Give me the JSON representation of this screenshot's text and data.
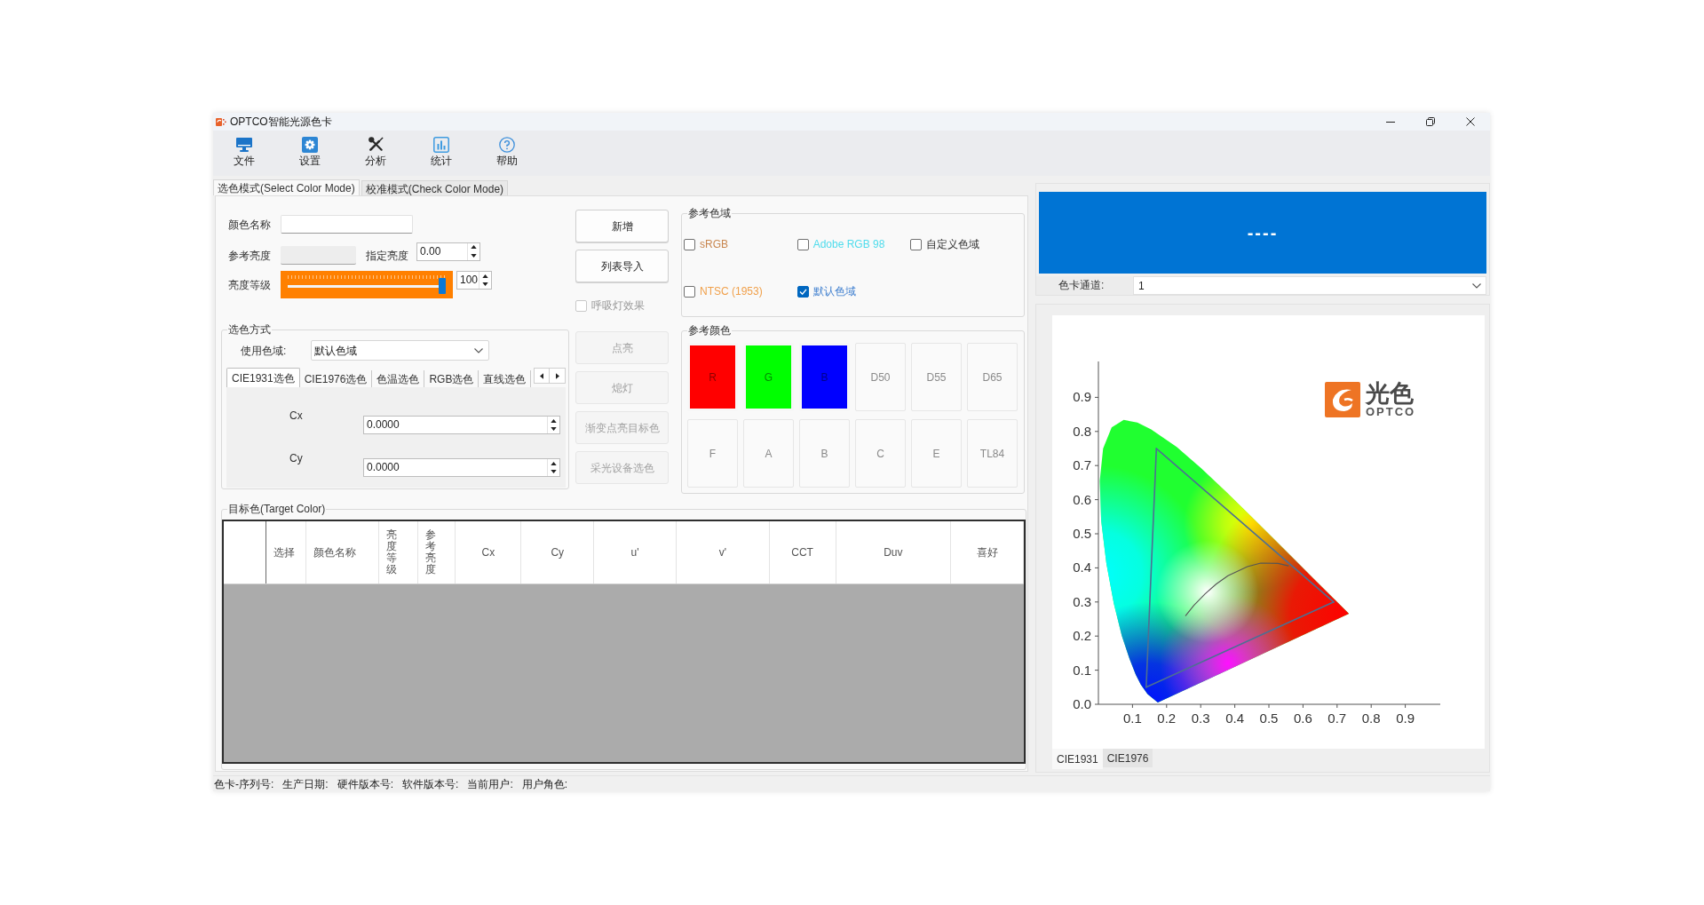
{
  "window": {
    "title": "OPTCO智能光源色卡"
  },
  "toolbar": [
    {
      "label": "文件"
    },
    {
      "label": "设置"
    },
    {
      "label": "分析"
    },
    {
      "label": "统计"
    },
    {
      "label": "帮助"
    }
  ],
  "mode_tabs": [
    {
      "label": "选色模式(Select Color Mode)",
      "selected": true
    },
    {
      "label": "校准模式(Check Color Mode)",
      "selected": false
    }
  ],
  "color_form": {
    "name": {
      "label": "颜色名称"
    },
    "reference_brightness": {
      "label": "参考亮度"
    },
    "set_brightness": {
      "label": "指定亮度",
      "value": "0.00"
    },
    "brightness_level": {
      "label": "亮度等级",
      "level": 1,
      "value": "100"
    }
  },
  "select_method": {
    "title": "选色方式",
    "gamut": {
      "label": "使用色域:",
      "value": "默认色域"
    },
    "tabs": [
      {
        "label": "CIE1931选色",
        "selected": true
      },
      {
        "label": "CIE1976选色",
        "selected": false
      },
      {
        "label": "色温选色",
        "selected": false
      },
      {
        "label": "RGB选色",
        "selected": false
      },
      {
        "label": "直线选色",
        "selected": false
      }
    ],
    "fields": [
      {
        "label": "Cx",
        "value": "0.0000"
      },
      {
        "label": "Cy",
        "value": "0.0000"
      }
    ]
  },
  "actions": [
    {
      "kind": "button",
      "label": "新增",
      "disabled": false
    },
    {
      "kind": "button",
      "label": "列表导入",
      "disabled": false
    },
    {
      "kind": "checkbox",
      "label": "呼吸灯效果",
      "checked": false,
      "disabled": true
    },
    {
      "kind": "button",
      "label": "点亮",
      "disabled": true
    },
    {
      "kind": "button",
      "label": "熄灯",
      "disabled": true
    },
    {
      "kind": "button",
      "label": "渐变点亮目标色",
      "disabled": true
    },
    {
      "kind": "button",
      "label": "采光设备选色",
      "disabled": true
    }
  ],
  "reference_gamut": {
    "title": "参考色域",
    "options": [
      {
        "label": "sRGB",
        "checked": false,
        "color": "#c8864f"
      },
      {
        "label": "Adobe RGB 98",
        "checked": false,
        "color": "#4fdcec"
      },
      {
        "label": "自定义色域",
        "checked": false,
        "color": "#333333"
      },
      {
        "label": "NTSC (1953)",
        "checked": false,
        "color": "#f0a04b"
      },
      {
        "label": "默认色域",
        "checked": true,
        "color": "#3f7fcf"
      }
    ]
  },
  "reference_colors": {
    "title": "参考颜色",
    "swatches": [
      {
        "label": "R",
        "color": "#ff0000"
      },
      {
        "label": "G",
        "color": "#00ff00"
      },
      {
        "label": "B",
        "color": "#0000ff"
      },
      {
        "label": "D50"
      },
      {
        "label": "D55"
      },
      {
        "label": "D65"
      },
      {
        "label": "F"
      },
      {
        "label": "A"
      },
      {
        "label": "B"
      },
      {
        "label": "C"
      },
      {
        "label": "E"
      },
      {
        "label": "TL84"
      }
    ]
  },
  "target_color": {
    "title": "目标色(Target Color)",
    "columns": [
      "选择",
      "颜色名称",
      "亮度等级",
      "参考亮度",
      "Cx",
      "Cy",
      "u'",
      "v'",
      "CCT",
      "Duv",
      "喜好"
    ]
  },
  "display": {
    "text": "----"
  },
  "channel": {
    "label": "色卡通道:",
    "value": "1"
  },
  "chart_panel": {
    "logo": {
      "title": "光色",
      "subtitle": "OPTCO"
    },
    "chart_data": {
      "type": "line",
      "xlim": [
        0,
        1
      ],
      "ylim": [
        0,
        1
      ],
      "xticks": [
        0.1,
        0.2,
        0.3,
        0.4,
        0.5,
        0.6,
        0.7,
        0.8,
        0.9
      ],
      "yticks": [
        {
          "value": 0,
          "label": "0.0"
        },
        0.1,
        0.2,
        0.3,
        0.4,
        0.5,
        0.6,
        0.7,
        0.8,
        0.9
      ],
      "series": [
        {
          "color": "#4d6f93",
          "x": [
            0.17,
            0.69
          ],
          "values": [
            0.75,
            0.3
          ]
        },
        {
          "color": "#4d6f93",
          "x": [
            0.14,
            0.69
          ],
          "values": [
            0.05,
            0.3
          ]
        },
        {
          "color": "#4d6f93",
          "x": [
            0.14,
            0.17
          ],
          "values": [
            0.05,
            0.75
          ]
        },
        {
          "color": "#555555",
          "x": [
            0.256,
            0.28,
            0.313,
            0.345,
            0.38,
            0.437,
            0.476,
            0.527,
            0.557
          ],
          "values": [
            0.26,
            0.29,
            0.324,
            0.352,
            0.377,
            0.404,
            0.414,
            0.413,
            0.406
          ]
        }
      ]
    },
    "tabs": [
      {
        "label": "CIE1931",
        "selected": true
      },
      {
        "label": "CIE1976",
        "selected": false
      }
    ]
  },
  "status_bar": [
    "色卡-序列号:",
    "生产日期:",
    "硬件版本号:",
    "软件版本号:",
    "当前用户:",
    "用户角色:"
  ]
}
